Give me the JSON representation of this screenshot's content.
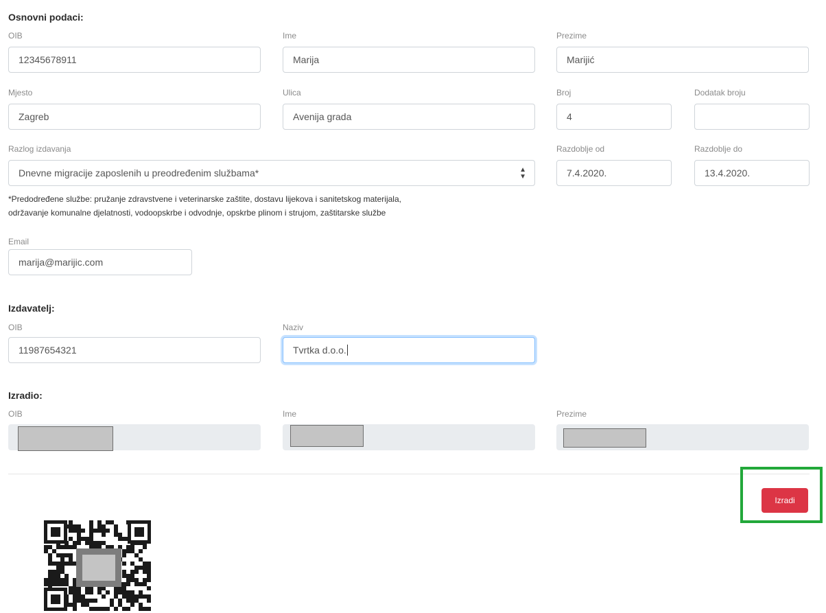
{
  "basic": {
    "title": "Osnovni podaci:",
    "oib_label": "OIB",
    "oib_value": "12345678911",
    "ime_label": "Ime",
    "ime_value": "Marija",
    "prezime_label": "Prezime",
    "prezime_value": "Marijić",
    "mjesto_label": "Mjesto",
    "mjesto_value": "Zagreb",
    "ulica_label": "Ulica",
    "ulica_value": "Avenija grada",
    "broj_label": "Broj",
    "broj_value": "4",
    "dodatak_label": "Dodatak broju",
    "dodatak_value": "",
    "razlog_label": "Razlog izdavanja",
    "razlog_value": "Dnevne migracije zaposlenih u preodređenim službama*",
    "od_label": "Razdoblje od",
    "od_value": "7.4.2020.",
    "do_label": "Razdoblje do",
    "do_value": "13.4.2020.",
    "note_line1": "*Predodređene službe: pružanje zdravstvene i veterinarske zaštite, dostavu lijekova i sanitetskog materijala,",
    "note_line2": "održavanje komunalne djelatnosti, vodoopskrbe i odvodnje, opskrbe plinom i strujom, zaštitarske službe",
    "email_label": "Email",
    "email_value": "marija@marijic.com"
  },
  "issuer": {
    "title": "Izdavatelj:",
    "oib_label": "OIB",
    "oib_value": "11987654321",
    "naziv_label": "Naziv",
    "naziv_value": "Tvrtka d.o.o."
  },
  "creator": {
    "title": "Izradio:",
    "oib_label": "OIB",
    "ime_label": "Ime",
    "prezime_label": "Prezime"
  },
  "actions": {
    "submit_label": "Izradi",
    "highlight_color": "#22a83a",
    "button_color": "#dc3545"
  },
  "icons": {
    "select_arrow": "chevron-updown-icon",
    "qr": "qr-code-icon"
  }
}
